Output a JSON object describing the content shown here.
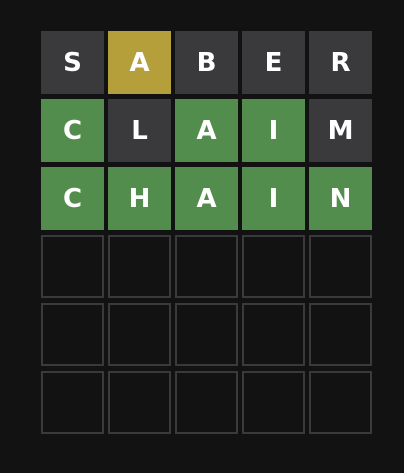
{
  "colors": {
    "background": "#121213",
    "absent": "#3a3a3c",
    "present": "#b59f3b",
    "correct": "#538d4e",
    "empty_border": "#3a3a3c",
    "text": "#ffffff"
  },
  "board": {
    "rows": [
      {
        "tiles": [
          {
            "letter": "S",
            "state": "absent"
          },
          {
            "letter": "A",
            "state": "present"
          },
          {
            "letter": "B",
            "state": "absent"
          },
          {
            "letter": "E",
            "state": "absent"
          },
          {
            "letter": "R",
            "state": "absent"
          }
        ]
      },
      {
        "tiles": [
          {
            "letter": "C",
            "state": "correct"
          },
          {
            "letter": "L",
            "state": "absent"
          },
          {
            "letter": "A",
            "state": "correct"
          },
          {
            "letter": "I",
            "state": "correct"
          },
          {
            "letter": "M",
            "state": "absent"
          }
        ]
      },
      {
        "tiles": [
          {
            "letter": "C",
            "state": "correct"
          },
          {
            "letter": "H",
            "state": "correct"
          },
          {
            "letter": "A",
            "state": "correct"
          },
          {
            "letter": "I",
            "state": "correct"
          },
          {
            "letter": "N",
            "state": "correct"
          }
        ]
      },
      {
        "tiles": [
          {
            "letter": "",
            "state": "empty"
          },
          {
            "letter": "",
            "state": "empty"
          },
          {
            "letter": "",
            "state": "empty"
          },
          {
            "letter": "",
            "state": "empty"
          },
          {
            "letter": "",
            "state": "empty"
          }
        ]
      },
      {
        "tiles": [
          {
            "letter": "",
            "state": "empty"
          },
          {
            "letter": "",
            "state": "empty"
          },
          {
            "letter": "",
            "state": "empty"
          },
          {
            "letter": "",
            "state": "empty"
          },
          {
            "letter": "",
            "state": "empty"
          }
        ]
      },
      {
        "tiles": [
          {
            "letter": "",
            "state": "empty"
          },
          {
            "letter": "",
            "state": "empty"
          },
          {
            "letter": "",
            "state": "empty"
          },
          {
            "letter": "",
            "state": "empty"
          },
          {
            "letter": "",
            "state": "empty"
          }
        ]
      }
    ]
  }
}
